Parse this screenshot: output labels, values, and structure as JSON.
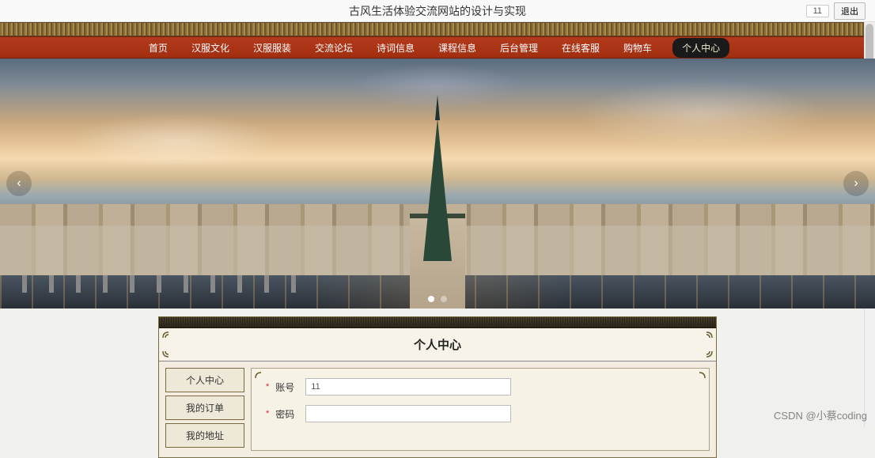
{
  "header": {
    "title": "古风生活体验交流网站的设计与实现",
    "user_id": "11",
    "logout_label": "退出"
  },
  "nav": {
    "items": [
      {
        "label": "首页"
      },
      {
        "label": "汉服文化"
      },
      {
        "label": "汉服服装"
      },
      {
        "label": "交流论坛"
      },
      {
        "label": "诗词信息"
      },
      {
        "label": "课程信息"
      },
      {
        "label": "后台管理"
      },
      {
        "label": "在线客服"
      },
      {
        "label": "购物车"
      },
      {
        "label": "个人中心",
        "active": true
      }
    ]
  },
  "carousel": {
    "prev_icon": "‹",
    "next_icon": "›",
    "dot_count": 2,
    "active_dot": 0
  },
  "panel": {
    "title": "个人中心",
    "sidebar": [
      {
        "label": "个人中心"
      },
      {
        "label": "我的订单"
      },
      {
        "label": "我的地址"
      }
    ],
    "form": {
      "account_label": "账号",
      "account_value": "11",
      "password_label": "密码",
      "password_value": ""
    }
  },
  "watermark": "CSDN @小蔡coding"
}
